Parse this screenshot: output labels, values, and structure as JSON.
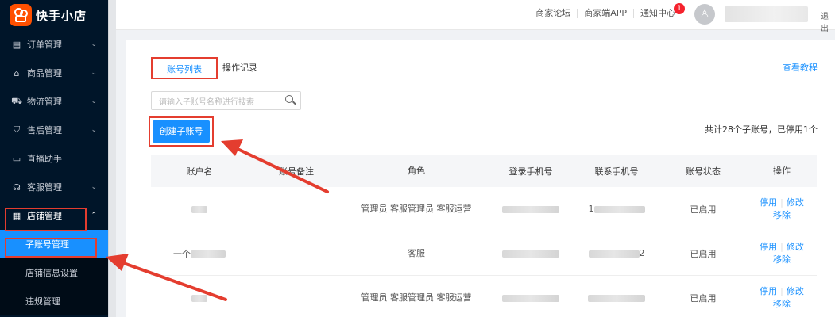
{
  "logo": {
    "text": "快手小店"
  },
  "sidebar": {
    "items": [
      {
        "label": "订单管理",
        "icon": "order-icon",
        "glyph": "▤",
        "arrow": "⌄"
      },
      {
        "label": "商品管理",
        "icon": "goods-icon",
        "glyph": "⌂",
        "arrow": "⌄"
      },
      {
        "label": "物流管理",
        "icon": "truck-icon",
        "glyph": "⛟",
        "arrow": "⌄"
      },
      {
        "label": "售后管理",
        "icon": "shield-icon",
        "glyph": "⛉",
        "arrow": "⌄"
      },
      {
        "label": "直播助手",
        "icon": "live-camera-icon",
        "glyph": "▭",
        "arrow": ""
      },
      {
        "label": "客服管理",
        "icon": "headset-icon",
        "glyph": "☊",
        "arrow": "⌄"
      },
      {
        "label": "店铺管理",
        "icon": "store-icon",
        "glyph": "▦",
        "arrow": "⌃"
      }
    ],
    "submenu": [
      {
        "label": "子账号管理",
        "active": true
      },
      {
        "label": "店铺信息设置",
        "active": false
      },
      {
        "label": "违规管理",
        "active": false
      }
    ]
  },
  "header": {
    "links": [
      "商家论坛",
      "商家端APP",
      "通知中心"
    ],
    "notification_count": "1",
    "avatar_glyph": "♙",
    "logout": "退出"
  },
  "tabs": [
    {
      "label": "账号列表",
      "active": true
    },
    {
      "label": "操作记录",
      "active": false
    }
  ],
  "tutorial_link": "查看教程",
  "search": {
    "placeholder": "请输入子账号名称进行搜索"
  },
  "create_button": "创建子账号",
  "summary": "共计28个子账号，已停用1个",
  "table": {
    "headers": [
      "账户名",
      "账号备注",
      "角色",
      "登录手机号",
      "联系手机号",
      "账号状态",
      "操作"
    ],
    "rows": [
      {
        "account": "",
        "note": "",
        "role": "管理员 客服管理员 客服运营",
        "login_phone": "",
        "contact_phone": "1",
        "status": "已启用",
        "disable": "停用",
        "edit": "修改",
        "remove": "移除"
      },
      {
        "account": "一个",
        "note": "",
        "role": "客服",
        "login_phone": "",
        "contact_phone": "2",
        "status": "已启用",
        "disable": "停用",
        "edit": "修改",
        "remove": "移除"
      },
      {
        "account": "",
        "note": "",
        "role": "管理员 客服管理员 客服运营",
        "login_phone": "",
        "contact_phone": "",
        "status": "已启用",
        "disable": "停用",
        "edit": "修改",
        "remove": "移除"
      }
    ]
  },
  "colors": {
    "accent": "#1890ff",
    "sidebar_bg": "#001529",
    "annotation": "#e43d2f",
    "badge": "#f5222d",
    "logo": "#ff5000"
  }
}
